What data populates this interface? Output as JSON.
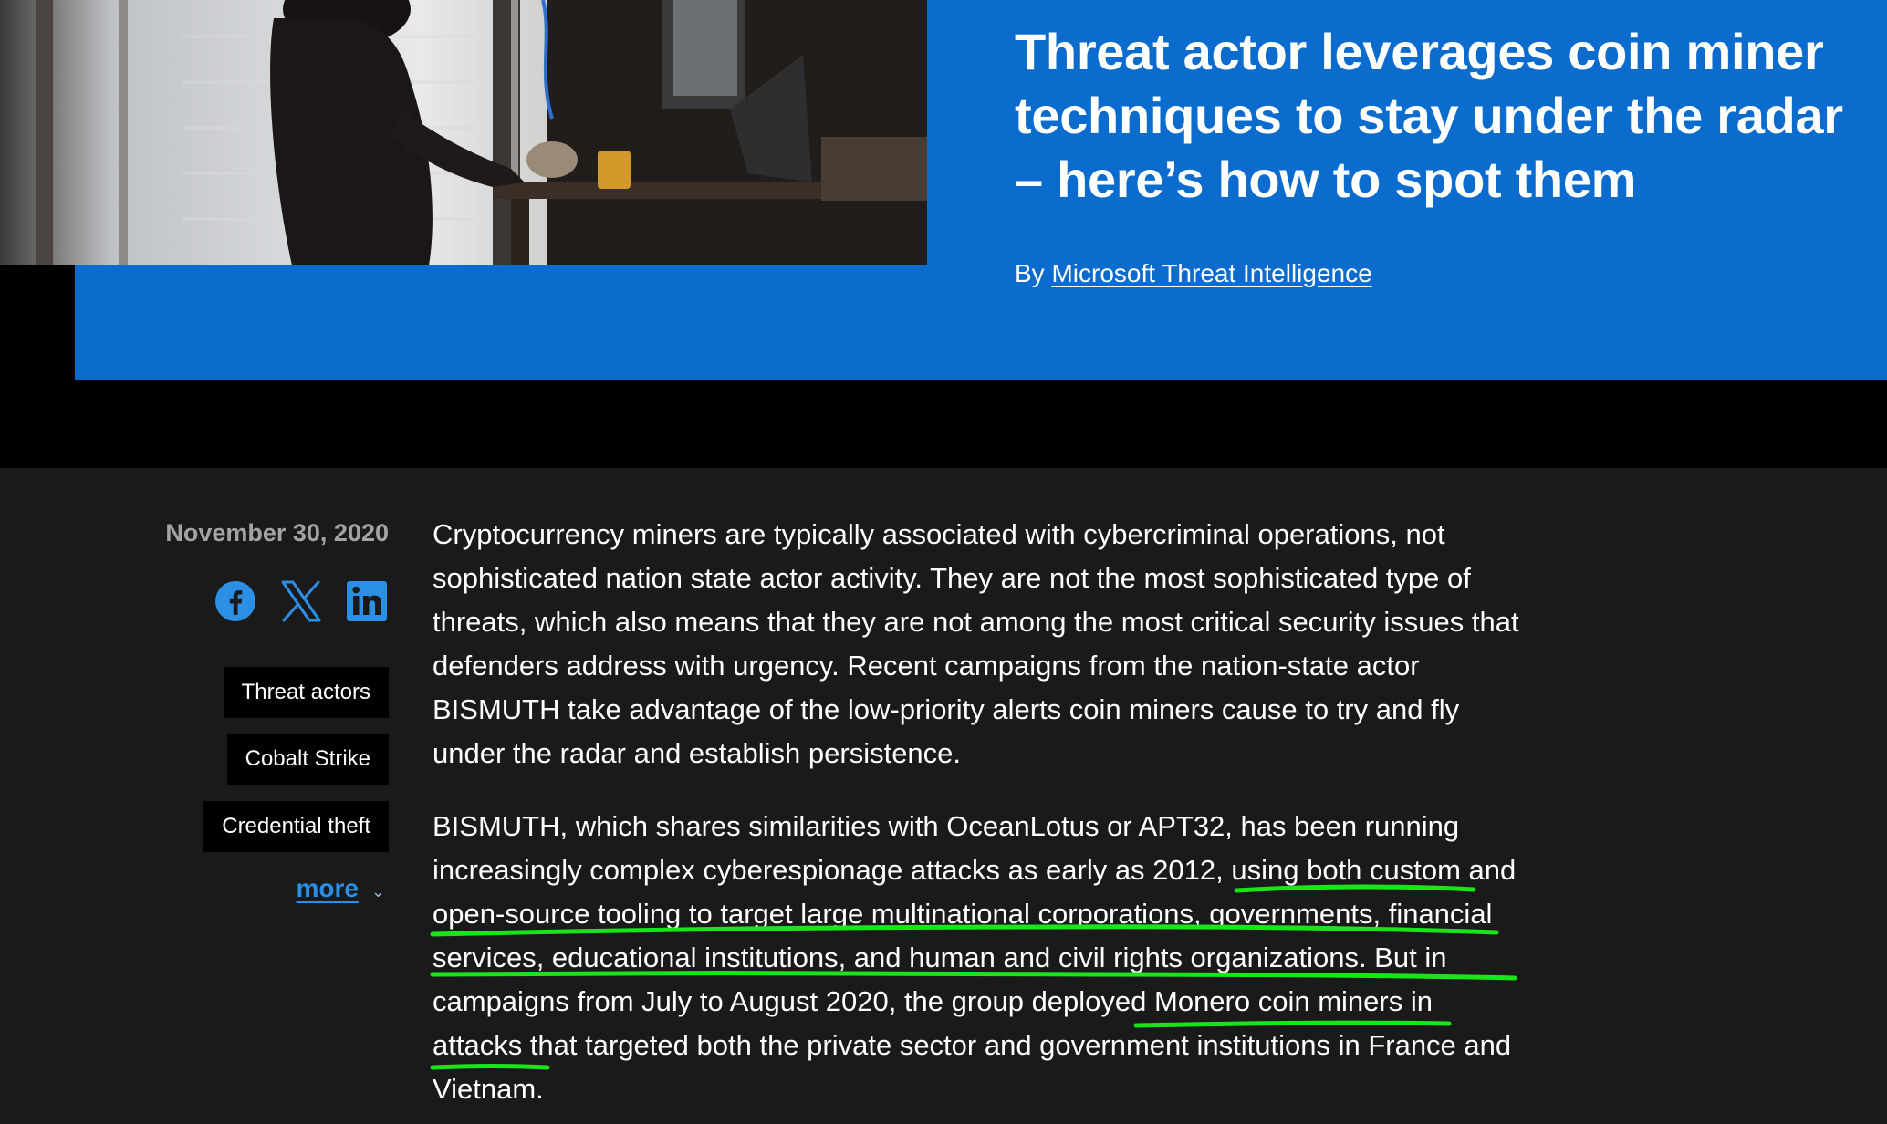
{
  "hero": {
    "title": "Threat actor leverages coin miner techniques to stay under the radar – here’s how to spot them",
    "byline_prefix": "By",
    "byline_author": "Microsoft Threat Intelligence"
  },
  "sidebar": {
    "date": "November 30, 2020",
    "share": [
      {
        "icon": "facebook-icon"
      },
      {
        "icon": "x-icon"
      },
      {
        "icon": "linkedin-icon"
      }
    ],
    "tags": [
      "Threat actors",
      "Cobalt Strike",
      "Credential theft"
    ],
    "more_label": "more"
  },
  "article": {
    "p1": "Cryptocurrency miners are typically associated with cybercriminal operations, not sophisticated nation state actor activity. They are not the most sophisticated type of threats, which also means that they are not among the most critical security issues that defenders address with urgency. Recent campaigns from the nation-state actor BISMUTH take advantage of the low-priority alerts coin miners cause to try and fly under the radar and establish persistence.",
    "p2_part1": "BISMUTH, which shares similarities with OceanLotus or APT32, has been running increasingly complex cyberespionage attacks as early as 2012, ",
    "p2_highlight1": "using both custom and open-source tooling to target large multinational corporations, governments, financial services, educational institutions, and human and civil rights organizations.",
    "p2_part2": " But in campaigns from July to August 2020, the group ",
    "p2_highlight2": "deployed Monero coin miners in",
    "p2_part3": " attacks that targeted both the private sector and government institutions in France and Vietnam."
  },
  "colors": {
    "hero_blue": "#0b6cce",
    "article_bg": "#1a1a1a",
    "link_blue": "#2b8fe6",
    "annotation_green": "#19e619"
  }
}
